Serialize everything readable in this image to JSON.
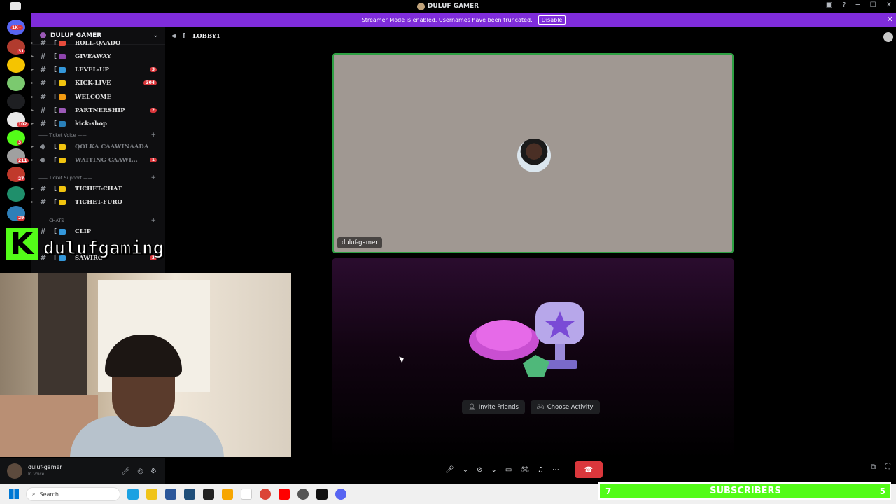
{
  "window": {
    "title": "DULUF GAMER"
  },
  "banner": {
    "text": "Streamer Mode is enabled. Usernames have been truncated.",
    "disable_label": "Disable"
  },
  "servers": [
    {
      "color": "#b13b2e",
      "badge": "31"
    },
    {
      "color": "#f5c400",
      "badge": ""
    },
    {
      "color": "#7bc96f",
      "badge": ""
    },
    {
      "color": "#1e1f22",
      "badge": ""
    },
    {
      "color": "#e8e8e8",
      "badge": "102"
    },
    {
      "color": "#53fc18",
      "badge": "3"
    },
    {
      "color": "#a0a0a0",
      "badge": "211"
    },
    {
      "color": "#c0392b",
      "badge": "27"
    },
    {
      "color": "#1f8f6b",
      "badge": ""
    },
    {
      "color": "#2e7fb8",
      "badge": "29"
    }
  ],
  "top_badge": "1K+",
  "server_header": {
    "name": "DULUF GAMER"
  },
  "channels": [
    {
      "name": "ROLL-QAADO",
      "count": ""
    },
    {
      "name": "GIVEAWAY",
      "count": ""
    },
    {
      "name": "LEVEL-UP",
      "count": "3"
    },
    {
      "name": "KICK-LIVE",
      "count": "304"
    },
    {
      "name": "WELCOME",
      "count": ""
    },
    {
      "name": "PARTNERSHIP",
      "count": "2"
    },
    {
      "name": "kick-shop",
      "count": ""
    }
  ],
  "category_ticket_voice": "Ticket Voice",
  "voice_channels": [
    {
      "name": "QOLKA CAAWINAADA",
      "count": ""
    },
    {
      "name": "WAITING CAAWI...",
      "count": "1"
    }
  ],
  "category_ticket_support": "Ticket Support",
  "support_channels": [
    {
      "name": "TICHET-CHAT",
      "count": ""
    },
    {
      "name": "TICHET-FURO",
      "count": ""
    }
  ],
  "category_chats": "CHATS",
  "chat_channels": [
    {
      "name": "CLIP",
      "count": ""
    },
    {
      "name": "SAWIRO",
      "count": "3"
    }
  ],
  "voice": {
    "channel": "LOBBY1"
  },
  "tile_user": {
    "name": "duluf-gamer"
  },
  "activity": {
    "invite_label": "Invite Friends",
    "choose_label": "Choose Activity"
  },
  "overlay": {
    "brand_letter": "K",
    "brand_name": "dulufgaming"
  },
  "user": {
    "name": "duluf-gamer",
    "status": "In voice"
  },
  "taskbar": {
    "search_placeholder": "Search"
  },
  "subs": {
    "left": "7",
    "label": "SUBSCRIBERS",
    "right": "5"
  }
}
